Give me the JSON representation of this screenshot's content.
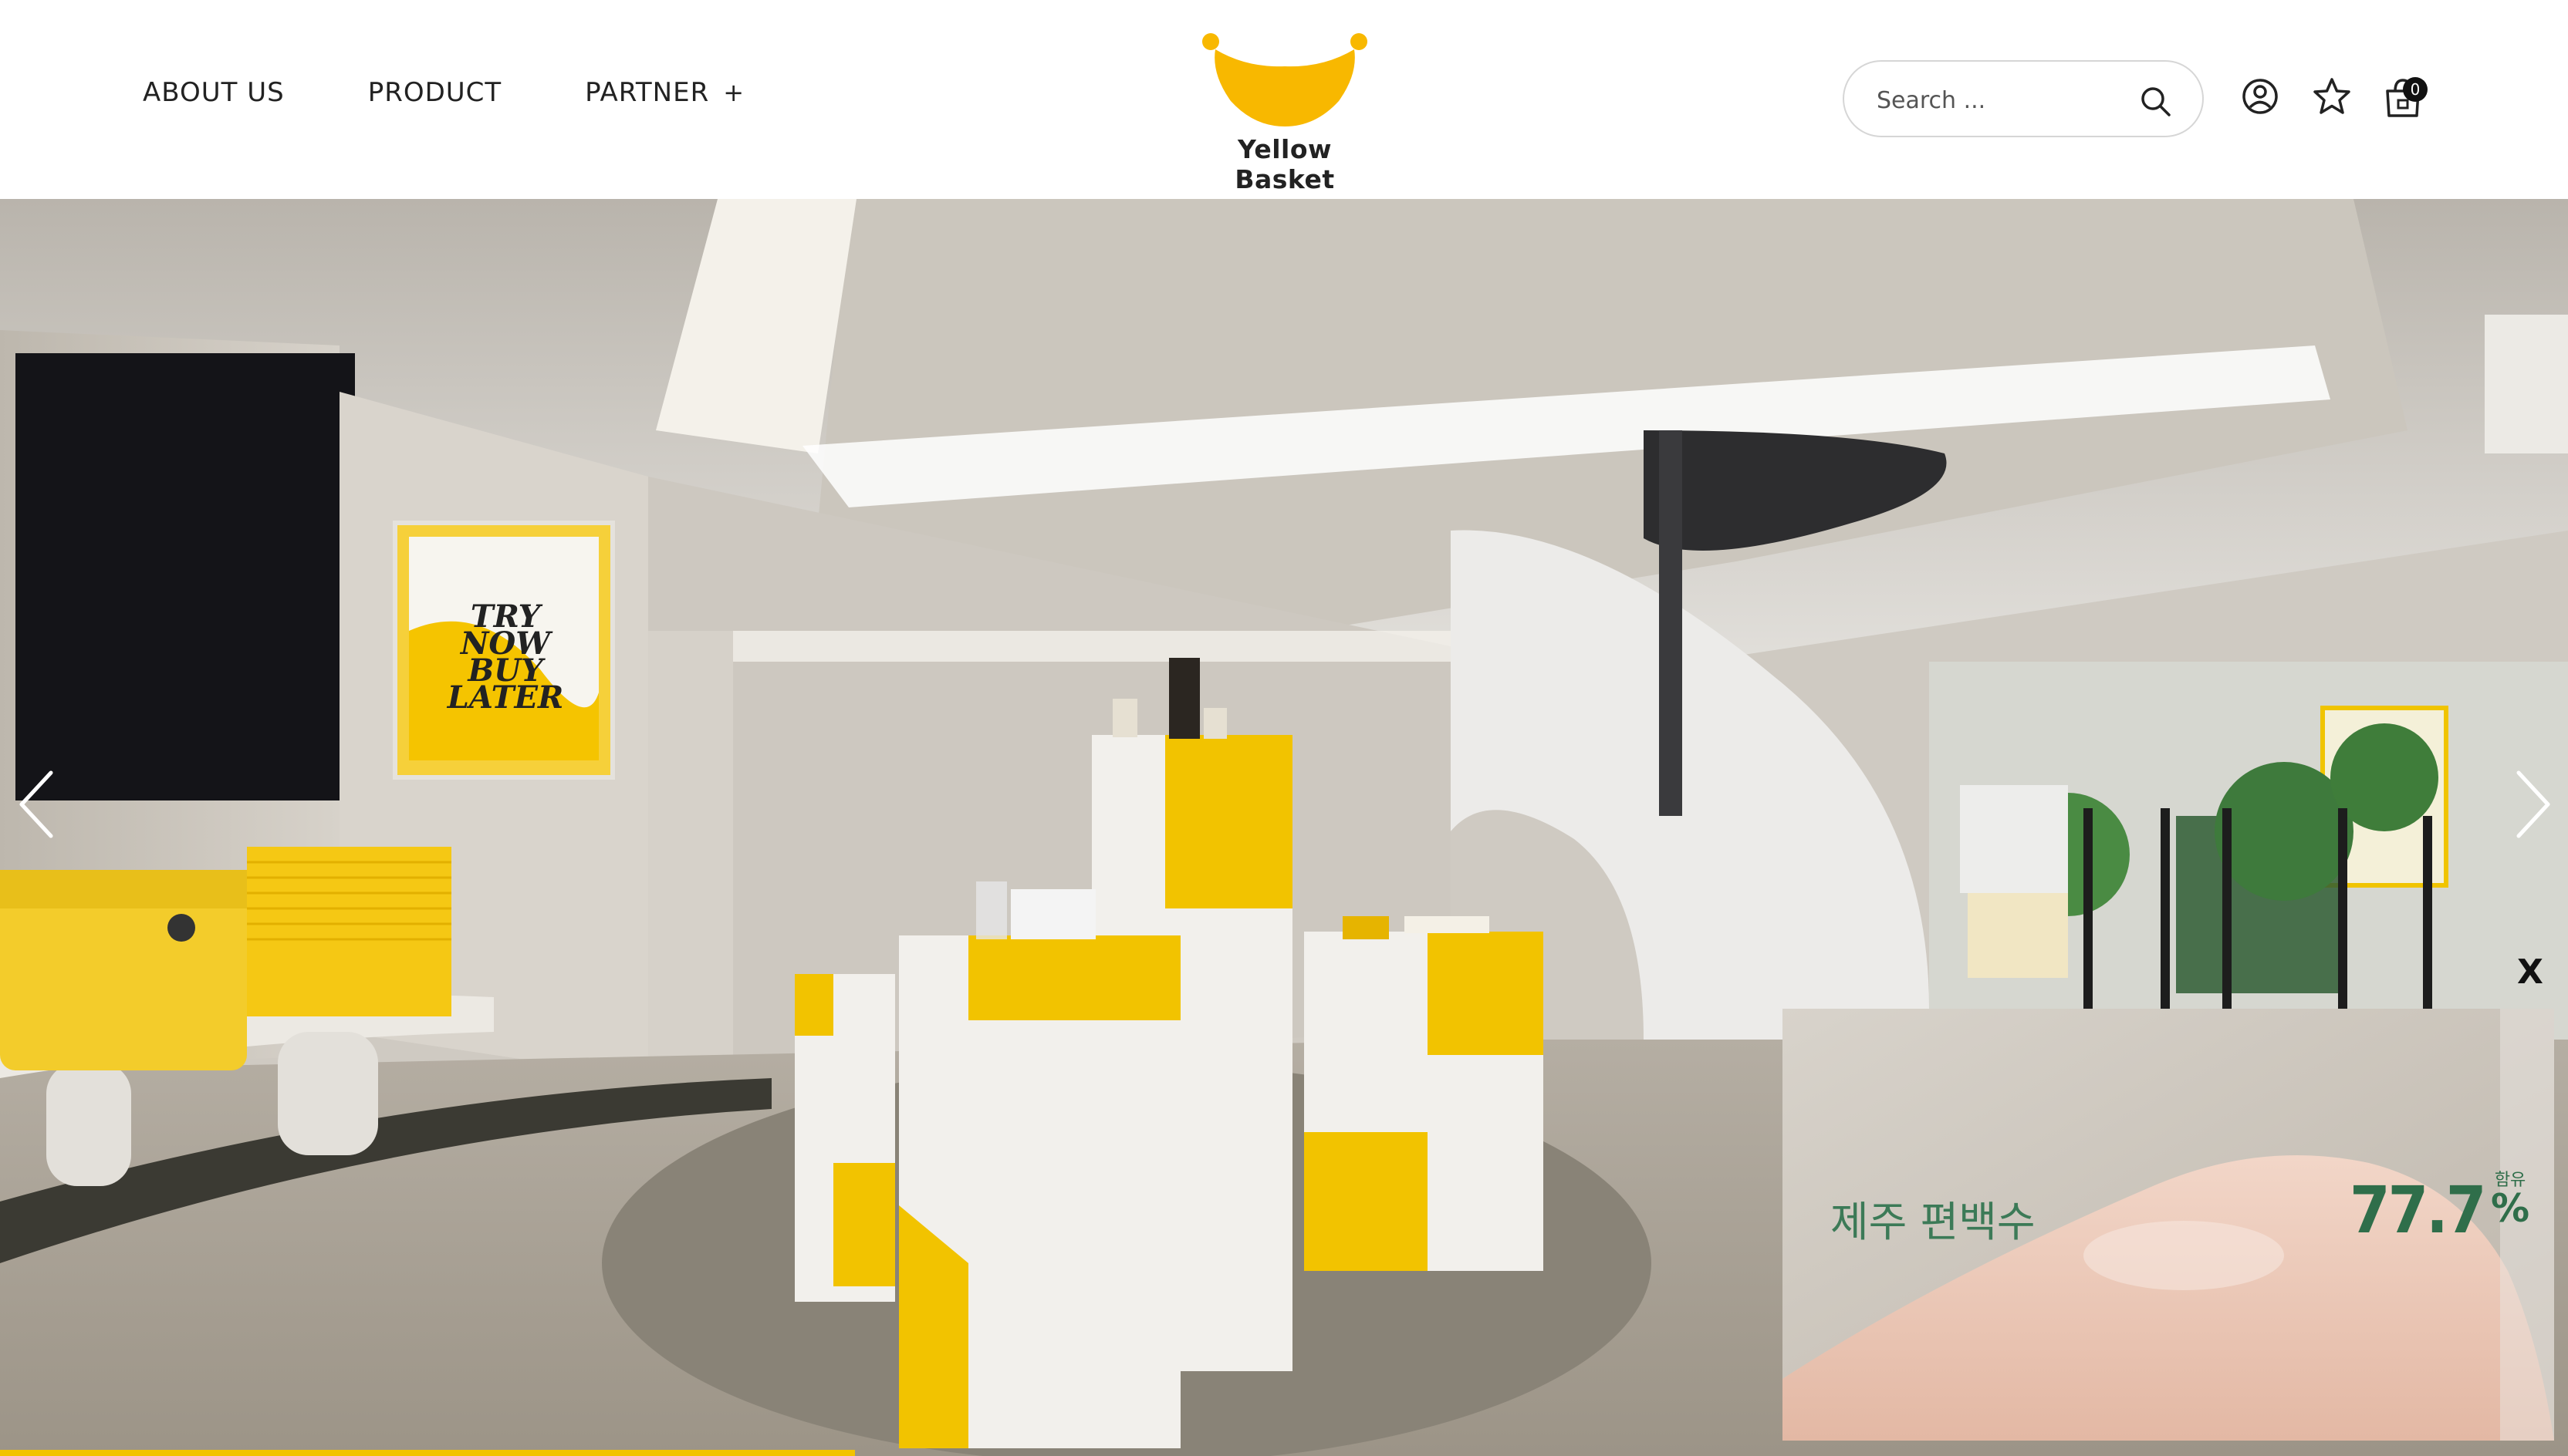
{
  "nav": {
    "about": "ABOUT US",
    "product": "PRODUCT",
    "partner": "PARTNER",
    "partner_expand": "+"
  },
  "brand": {
    "name": "Yellow Basket",
    "color": "#f8b800"
  },
  "search": {
    "placeholder": "Search ..."
  },
  "header_icons": [
    "user-circle-icon",
    "star-icon",
    "shopping-bag-icon"
  ],
  "cart": {
    "count": "0"
  },
  "hero": {
    "poster_lines": [
      "TRY",
      "NOW",
      "BUY",
      "LATER"
    ],
    "accent": "#f2c300",
    "slide_progress": 0.333
  },
  "video_popup": {
    "close": "X",
    "caption": "제주 편백수",
    "percent": "77.7",
    "percent_label": "함유",
    "percent_sign": "%"
  }
}
